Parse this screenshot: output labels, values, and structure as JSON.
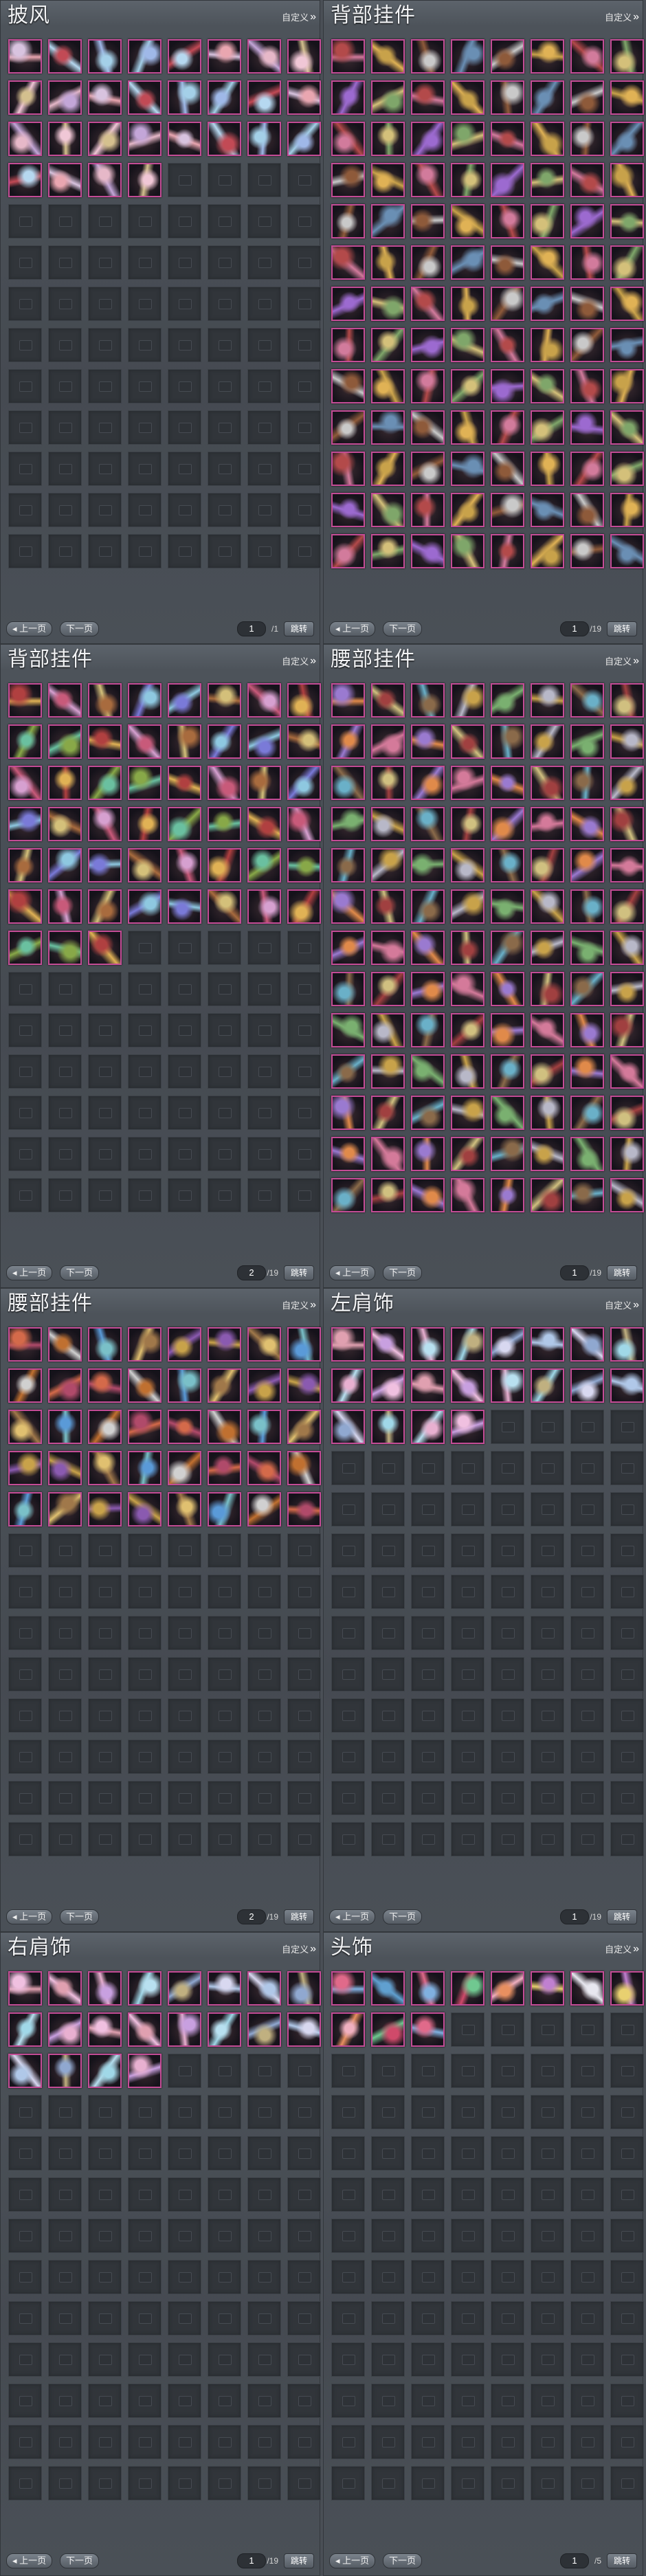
{
  "ui": {
    "custom_label": "自定义",
    "prev_label": "上一页",
    "next_label": "下一页",
    "jump_label": "跳转"
  },
  "panels": [
    {
      "title": "披风",
      "page": "1",
      "total": "/1",
      "filled": 28,
      "palette": [
        "#d8c3df",
        "#9fb8e8",
        "#e6b8c8",
        "#c3a6d8",
        "#a4d0e8",
        "#e9a6b0",
        "#d4c08e",
        "#c24a55",
        "#b6d8f0",
        "#f0c7d6"
      ]
    },
    {
      "title": "背部挂件",
      "page": "1",
      "total": "/19",
      "filled": 104,
      "palette": [
        "#c8a24a",
        "#8e5a3a",
        "#d4c07a",
        "#b34a4a",
        "#6a8fb4",
        "#d27b9c",
        "#7fa66a",
        "#c9c9c9",
        "#e0b255",
        "#9c6ad0"
      ]
    },
    {
      "title": "背部挂件",
      "page": "2",
      "total": "/19",
      "filled": 51,
      "palette": [
        "#a86b3e",
        "#d4c07a",
        "#6ac0a0",
        "#c85a7a",
        "#7a7ad8",
        "#e0b255",
        "#b04040",
        "#8ec8e0",
        "#d6a0d0",
        "#88a848"
      ]
    },
    {
      "title": "腰部挂件",
      "page": "1",
      "total": "/19",
      "filled": 104,
      "palette": [
        "#c8a24a",
        "#6ab0c8",
        "#d47a9a",
        "#8a6a4a",
        "#b8b8c8",
        "#e08a4a",
        "#a04040",
        "#7ab070",
        "#d0c080",
        "#9a7ad0"
      ]
    },
    {
      "title": "腰部挂件",
      "page": "2",
      "total": "/19",
      "filled": 40,
      "palette": [
        "#c8a24a",
        "#5a9ad8",
        "#d46a4a",
        "#a0784a",
        "#e0c070",
        "#b04a6a",
        "#7ac0c8",
        "#8a5ab0",
        "#d0d0d0",
        "#c07030"
      ]
    },
    {
      "title": "左肩饰",
      "page": "1",
      "total": "/19",
      "filled": 20,
      "palette": [
        "#b0c8e8",
        "#e8b0d0",
        "#c8a0e0",
        "#d8d8f0",
        "#a0d8e8",
        "#e0a0b0",
        "#c0b080",
        "#90a8d0",
        "#f0c0e0",
        "#b8e0f0"
      ]
    },
    {
      "title": "右肩饰",
      "page": "1",
      "total": "/19",
      "filled": 20,
      "palette": [
        "#b0c8e8",
        "#e8b0d0",
        "#c8a0e0",
        "#d8d8f0",
        "#a0d8e8",
        "#e0a0b0",
        "#c0b080",
        "#90a8d0",
        "#f0c0e0",
        "#b8e0f0"
      ]
    },
    {
      "title": "头饰",
      "page": "1",
      "total": "/5",
      "filled": 11,
      "palette": [
        "#e8d070",
        "#e06a8a",
        "#70c890",
        "#e8e8f0",
        "#d04a6a",
        "#80b0e0",
        "#c080d0",
        "#f0b0c0",
        "#60a0d0",
        "#e89060"
      ]
    }
  ]
}
